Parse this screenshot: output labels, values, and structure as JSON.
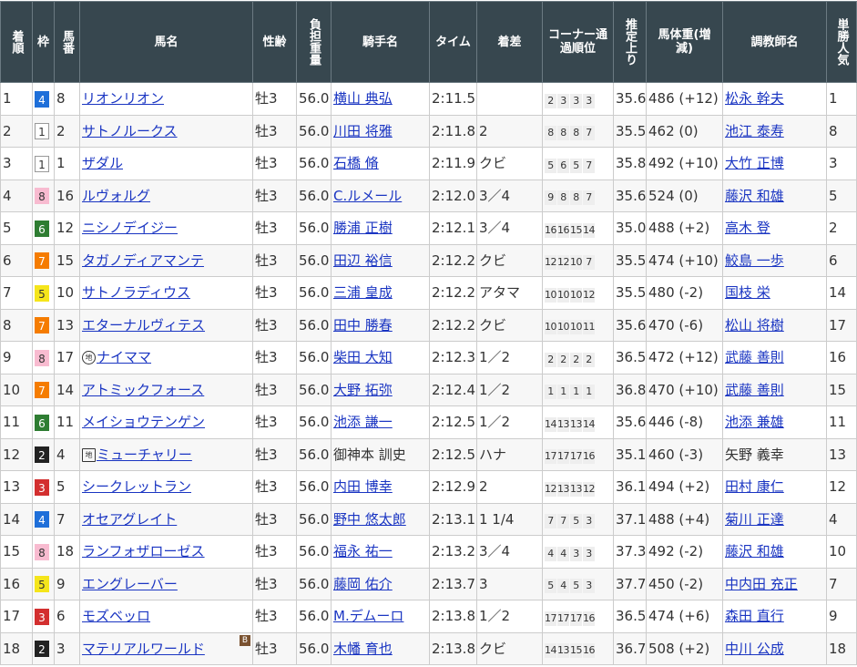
{
  "headers": {
    "rank": "着順",
    "waku": "枠",
    "umaban": "馬番",
    "horse": "馬名",
    "sexage": "性齢",
    "weight": "負担重量",
    "jockey": "騎手名",
    "time": "タイム",
    "margin": "着差",
    "corner": "コーナー通過順位",
    "agari": "推定上り",
    "bodyweight": "馬体重(増減)",
    "trainer": "調教師名",
    "odds": "単勝人気"
  },
  "colors": {
    "header_bg": "#37474f",
    "link": "#1a35c2",
    "waku_1": "#ffffff",
    "waku_2": "#222222",
    "waku_3": "#d32f2f",
    "waku_4": "#1e6fd9",
    "waku_5": "#f5e51b",
    "waku_6": "#2e7d32",
    "waku_7": "#f57c00",
    "waku_8": "#f8bbd0"
  },
  "rows": [
    {
      "rank": "1",
      "waku": "4",
      "umaban": "8",
      "horse": "リオンリオン",
      "mark": "",
      "blinker": "",
      "sexage": "牡3",
      "weight": "56.0",
      "jockey": "横山 典弘",
      "jockey_link": true,
      "time": "2:11.5",
      "margin": "",
      "corner": [
        "2",
        "3",
        "3",
        "3"
      ],
      "agari": "35.6",
      "bodyweight": "486 (+12)",
      "trainer": "松永 幹夫",
      "trainer_link": true,
      "odds": "1"
    },
    {
      "rank": "2",
      "waku": "1",
      "umaban": "2",
      "horse": "サトノルークス",
      "mark": "",
      "blinker": "",
      "sexage": "牡3",
      "weight": "56.0",
      "jockey": "川田 将雅",
      "jockey_link": true,
      "time": "2:11.8",
      "margin": "2",
      "corner": [
        "8",
        "8",
        "8",
        "7"
      ],
      "agari": "35.5",
      "bodyweight": "462 (0)",
      "trainer": "池江 泰寿",
      "trainer_link": true,
      "odds": "8"
    },
    {
      "rank": "3",
      "waku": "1",
      "umaban": "1",
      "horse": "ザダル",
      "mark": "",
      "blinker": "",
      "sexage": "牡3",
      "weight": "56.0",
      "jockey": "石橋 脩",
      "jockey_link": true,
      "time": "2:11.9",
      "margin": "クビ",
      "corner": [
        "5",
        "6",
        "5",
        "7"
      ],
      "agari": "35.8",
      "bodyweight": "492 (+10)",
      "trainer": "大竹 正博",
      "trainer_link": true,
      "odds": "3"
    },
    {
      "rank": "4",
      "waku": "8",
      "umaban": "16",
      "horse": "ルヴォルグ",
      "mark": "",
      "blinker": "",
      "sexage": "牡3",
      "weight": "56.0",
      "jockey": "C.ルメール",
      "jockey_link": true,
      "time": "2:12.0",
      "margin": "3／4",
      "corner": [
        "9",
        "8",
        "8",
        "7"
      ],
      "agari": "35.6",
      "bodyweight": "524 (0)",
      "trainer": "藤沢 和雄",
      "trainer_link": true,
      "odds": "5"
    },
    {
      "rank": "5",
      "waku": "6",
      "umaban": "12",
      "horse": "ニシノデイジー",
      "mark": "",
      "blinker": "",
      "sexage": "牡3",
      "weight": "56.0",
      "jockey": "勝浦 正樹",
      "jockey_link": true,
      "time": "2:12.1",
      "margin": "3／4",
      "corner": [
        "16",
        "16",
        "15",
        "14"
      ],
      "agari": "35.0",
      "bodyweight": "488 (+2)",
      "trainer": "高木 登",
      "trainer_link": true,
      "odds": "2"
    },
    {
      "rank": "6",
      "waku": "7",
      "umaban": "15",
      "horse": "タガノディアマンテ",
      "mark": "",
      "blinker": "",
      "sexage": "牡3",
      "weight": "56.0",
      "jockey": "田辺 裕信",
      "jockey_link": true,
      "time": "2:12.2",
      "margin": "クビ",
      "corner": [
        "12",
        "12",
        "10",
        "7"
      ],
      "agari": "35.5",
      "bodyweight": "474 (+10)",
      "trainer": "鮫島 一歩",
      "trainer_link": true,
      "odds": "6"
    },
    {
      "rank": "7",
      "waku": "5",
      "umaban": "10",
      "horse": "サトノラディウス",
      "mark": "",
      "blinker": "",
      "sexage": "牡3",
      "weight": "56.0",
      "jockey": "三浦 皇成",
      "jockey_link": true,
      "time": "2:12.2",
      "margin": "アタマ",
      "corner": [
        "10",
        "10",
        "10",
        "12"
      ],
      "agari": "35.5",
      "bodyweight": "480 (-2)",
      "trainer": "国枝 栄",
      "trainer_link": true,
      "odds": "14"
    },
    {
      "rank": "8",
      "waku": "7",
      "umaban": "13",
      "horse": "エターナルヴィテス",
      "mark": "",
      "blinker": "",
      "sexage": "牡3",
      "weight": "56.0",
      "jockey": "田中 勝春",
      "jockey_link": true,
      "time": "2:12.2",
      "margin": "クビ",
      "corner": [
        "10",
        "10",
        "10",
        "11"
      ],
      "agari": "35.6",
      "bodyweight": "470 (-6)",
      "trainer": "松山 将樹",
      "trainer_link": true,
      "odds": "17"
    },
    {
      "rank": "9",
      "waku": "8",
      "umaban": "17",
      "horse": "ナイママ",
      "mark": "地",
      "mark_shape": "circle",
      "blinker": "",
      "sexage": "牡3",
      "weight": "56.0",
      "jockey": "柴田 大知",
      "jockey_link": true,
      "time": "2:12.3",
      "margin": "1／2",
      "corner": [
        "2",
        "2",
        "2",
        "2"
      ],
      "agari": "36.5",
      "bodyweight": "472 (+12)",
      "trainer": "武藤 善則",
      "trainer_link": true,
      "odds": "16"
    },
    {
      "rank": "10",
      "waku": "7",
      "umaban": "14",
      "horse": "アトミックフォース",
      "mark": "",
      "blinker": "",
      "sexage": "牡3",
      "weight": "56.0",
      "jockey": "大野 拓弥",
      "jockey_link": true,
      "time": "2:12.4",
      "margin": "1／2",
      "corner": [
        "1",
        "1",
        "1",
        "1"
      ],
      "agari": "36.8",
      "bodyweight": "470 (+10)",
      "trainer": "武藤 善則",
      "trainer_link": true,
      "odds": "15"
    },
    {
      "rank": "11",
      "waku": "6",
      "umaban": "11",
      "horse": "メイショウテンゲン",
      "mark": "",
      "blinker": "",
      "sexage": "牡3",
      "weight": "56.0",
      "jockey": "池添 謙一",
      "jockey_link": true,
      "time": "2:12.5",
      "margin": "1／2",
      "corner": [
        "14",
        "13",
        "13",
        "14"
      ],
      "agari": "35.6",
      "bodyweight": "446 (-8)",
      "trainer": "池添 兼雄",
      "trainer_link": true,
      "odds": "11"
    },
    {
      "rank": "12",
      "waku": "2",
      "umaban": "4",
      "horse": "ミューチャリー",
      "mark": "地",
      "mark_shape": "square",
      "blinker": "",
      "sexage": "牡3",
      "weight": "56.0",
      "jockey": "御神本 訓史",
      "jockey_link": false,
      "time": "2:12.5",
      "margin": "ハナ",
      "corner": [
        "17",
        "17",
        "17",
        "16"
      ],
      "agari": "35.1",
      "bodyweight": "460 (-3)",
      "trainer": "矢野 義幸",
      "trainer_link": false,
      "odds": "13"
    },
    {
      "rank": "13",
      "waku": "3",
      "umaban": "5",
      "horse": "シークレットラン",
      "mark": "",
      "blinker": "",
      "sexage": "牡3",
      "weight": "56.0",
      "jockey": "内田 博幸",
      "jockey_link": true,
      "time": "2:12.9",
      "margin": "2",
      "corner": [
        "12",
        "13",
        "13",
        "12"
      ],
      "agari": "36.1",
      "bodyweight": "494 (+2)",
      "trainer": "田村 康仁",
      "trainer_link": true,
      "odds": "12"
    },
    {
      "rank": "14",
      "waku": "4",
      "umaban": "7",
      "horse": "オセアグレイト",
      "mark": "",
      "blinker": "",
      "sexage": "牡3",
      "weight": "56.0",
      "jockey": "野中 悠太郎",
      "jockey_link": true,
      "time": "2:13.1",
      "margin": "1 1/4",
      "corner": [
        "7",
        "7",
        "5",
        "3"
      ],
      "agari": "37.1",
      "bodyweight": "488 (+4)",
      "trainer": "菊川 正達",
      "trainer_link": true,
      "odds": "4"
    },
    {
      "rank": "15",
      "waku": "8",
      "umaban": "18",
      "horse": "ランフォザローゼス",
      "mark": "",
      "blinker": "",
      "sexage": "牡3",
      "weight": "56.0",
      "jockey": "福永 祐一",
      "jockey_link": true,
      "time": "2:13.2",
      "margin": "3／4",
      "corner": [
        "4",
        "4",
        "3",
        "3"
      ],
      "agari": "37.3",
      "bodyweight": "492 (-2)",
      "trainer": "藤沢 和雄",
      "trainer_link": true,
      "odds": "10"
    },
    {
      "rank": "16",
      "waku": "5",
      "umaban": "9",
      "horse": "エングレーバー",
      "mark": "",
      "blinker": "",
      "sexage": "牡3",
      "weight": "56.0",
      "jockey": "藤岡 佑介",
      "jockey_link": true,
      "time": "2:13.7",
      "margin": "3",
      "corner": [
        "5",
        "4",
        "5",
        "3"
      ],
      "agari": "37.7",
      "bodyweight": "450 (-2)",
      "trainer": "中内田 充正",
      "trainer_link": true,
      "odds": "7"
    },
    {
      "rank": "17",
      "waku": "3",
      "umaban": "6",
      "horse": "モズベッロ",
      "mark": "",
      "blinker": "",
      "sexage": "牡3",
      "weight": "56.0",
      "jockey": "M.デムーロ",
      "jockey_link": true,
      "time": "2:13.8",
      "margin": "1／2",
      "corner": [
        "17",
        "17",
        "17",
        "16"
      ],
      "agari": "36.5",
      "bodyweight": "474 (+6)",
      "trainer": "森田 直行",
      "trainer_link": true,
      "odds": "9"
    },
    {
      "rank": "18",
      "waku": "2",
      "umaban": "3",
      "horse": "マテリアルワールド",
      "mark": "",
      "blinker": "B",
      "sexage": "牡3",
      "weight": "56.0",
      "jockey": "木幡 育也",
      "jockey_link": true,
      "time": "2:13.8",
      "margin": "クビ",
      "corner": [
        "14",
        "13",
        "15",
        "16"
      ],
      "agari": "36.7",
      "bodyweight": "508 (+2)",
      "trainer": "中川 公成",
      "trainer_link": true,
      "odds": "18"
    }
  ]
}
